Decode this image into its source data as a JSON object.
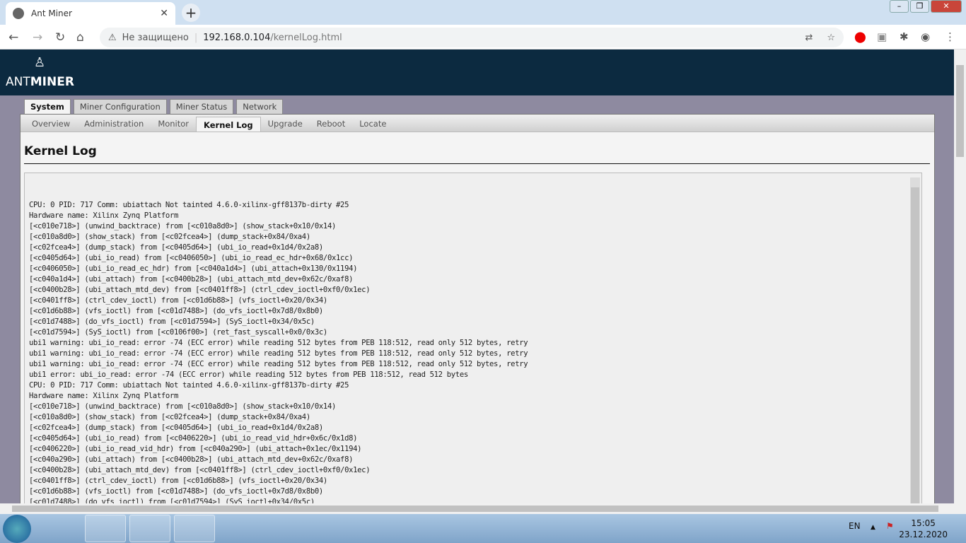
{
  "browser": {
    "tab_title": "Ant Miner",
    "new_tab": "+",
    "security": "Не защищено",
    "host": "192.168.0.104",
    "path": "/kernelLog.html"
  },
  "header": {
    "logo_light": "ANT",
    "logo_bold": "MINER"
  },
  "main_tabs": [
    {
      "label": "System",
      "active": true
    },
    {
      "label": "Miner Configuration"
    },
    {
      "label": "Miner Status"
    },
    {
      "label": "Network"
    }
  ],
  "sub_tabs": [
    {
      "label": "Overview"
    },
    {
      "label": "Administration"
    },
    {
      "label": "Monitor"
    },
    {
      "label": "Kernel Log",
      "active": true
    },
    {
      "label": "Upgrade"
    },
    {
      "label": "Reboot"
    },
    {
      "label": "Locate"
    }
  ],
  "page_title": "Kernel Log",
  "log_lines": [
    "CPU: 0 PID: 717 Comm: ubiattach Not tainted 4.6.0-xilinx-gff8137b-dirty #25",
    "Hardware name: Xilinx Zynq Platform",
    "[<c010e718>] (unwind_backtrace) from [<c010a8d0>] (show_stack+0x10/0x14)",
    "[<c010a8d0>] (show_stack) from [<c02fcea4>] (dump_stack+0x84/0xa4)",
    "[<c02fcea4>] (dump_stack) from [<c0405d64>] (ubi_io_read+0x1d4/0x2a8)",
    "[<c0405d64>] (ubi_io_read) from [<c0406050>] (ubi_io_read_ec_hdr+0x68/0x1cc)",
    "[<c0406050>] (ubi_io_read_ec_hdr) from [<c040a1d4>] (ubi_attach+0x130/0x1194)",
    "[<c040a1d4>] (ubi_attach) from [<c0400b28>] (ubi_attach_mtd_dev+0x62c/0xaf8)",
    "[<c0400b28>] (ubi_attach_mtd_dev) from [<c0401ff8>] (ctrl_cdev_ioctl+0xf0/0x1ec)",
    "[<c0401ff8>] (ctrl_cdev_ioctl) from [<c01d6b88>] (vfs_ioctl+0x20/0x34)",
    "[<c01d6b88>] (vfs_ioctl) from [<c01d7488>] (do_vfs_ioctl+0x7d8/0x8b0)",
    "[<c01d7488>] (do_vfs_ioctl) from [<c01d7594>] (SyS_ioctl+0x34/0x5c)",
    "[<c01d7594>] (SyS_ioctl) from [<c0106f00>] (ret_fast_syscall+0x0/0x3c)",
    "ubi1 warning: ubi_io_read: error -74 (ECC error) while reading 512 bytes from PEB 118:512, read only 512 bytes, retry",
    "ubi1 warning: ubi_io_read: error -74 (ECC error) while reading 512 bytes from PEB 118:512, read only 512 bytes, retry",
    "ubi1 warning: ubi_io_read: error -74 (ECC error) while reading 512 bytes from PEB 118:512, read only 512 bytes, retry",
    "ubi1 error: ubi_io_read: error -74 (ECC error) while reading 512 bytes from PEB 118:512, read 512 bytes",
    "CPU: 0 PID: 717 Comm: ubiattach Not tainted 4.6.0-xilinx-gff8137b-dirty #25",
    "Hardware name: Xilinx Zynq Platform",
    "[<c010e718>] (unwind_backtrace) from [<c010a8d0>] (show_stack+0x10/0x14)",
    "[<c010a8d0>] (show_stack) from [<c02fcea4>] (dump_stack+0x84/0xa4)",
    "[<c02fcea4>] (dump_stack) from [<c0405d64>] (ubi_io_read+0x1d4/0x2a8)",
    "[<c0405d64>] (ubi_io_read) from [<c0406220>] (ubi_io_read_vid_hdr+0x6c/0x1d8)",
    "[<c0406220>] (ubi_io_read_vid_hdr) from [<c040a290>] (ubi_attach+0x1ec/0x1194)",
    "[<c040a290>] (ubi_attach) from [<c0400b28>] (ubi_attach_mtd_dev+0x62c/0xaf8)",
    "[<c0400b28>] (ubi_attach_mtd_dev) from [<c0401ff8>] (ctrl_cdev_ioctl+0xf0/0x1ec)",
    "[<c0401ff8>] (ctrl_cdev_ioctl) from [<c01d6b88>] (vfs_ioctl+0x20/0x34)",
    "[<c01d6b88>] (vfs_ioctl) from [<c01d7488>] (do_vfs_ioctl+0x7d8/0x8b0)",
    "[<c01d7488>] (do_vfs_ioctl) from [<c01d7594>] (SyS_ioctl+0x34/0x5c)"
  ],
  "taskbar": {
    "lang": "EN",
    "time": "15:05",
    "date": "23.12.2020"
  }
}
